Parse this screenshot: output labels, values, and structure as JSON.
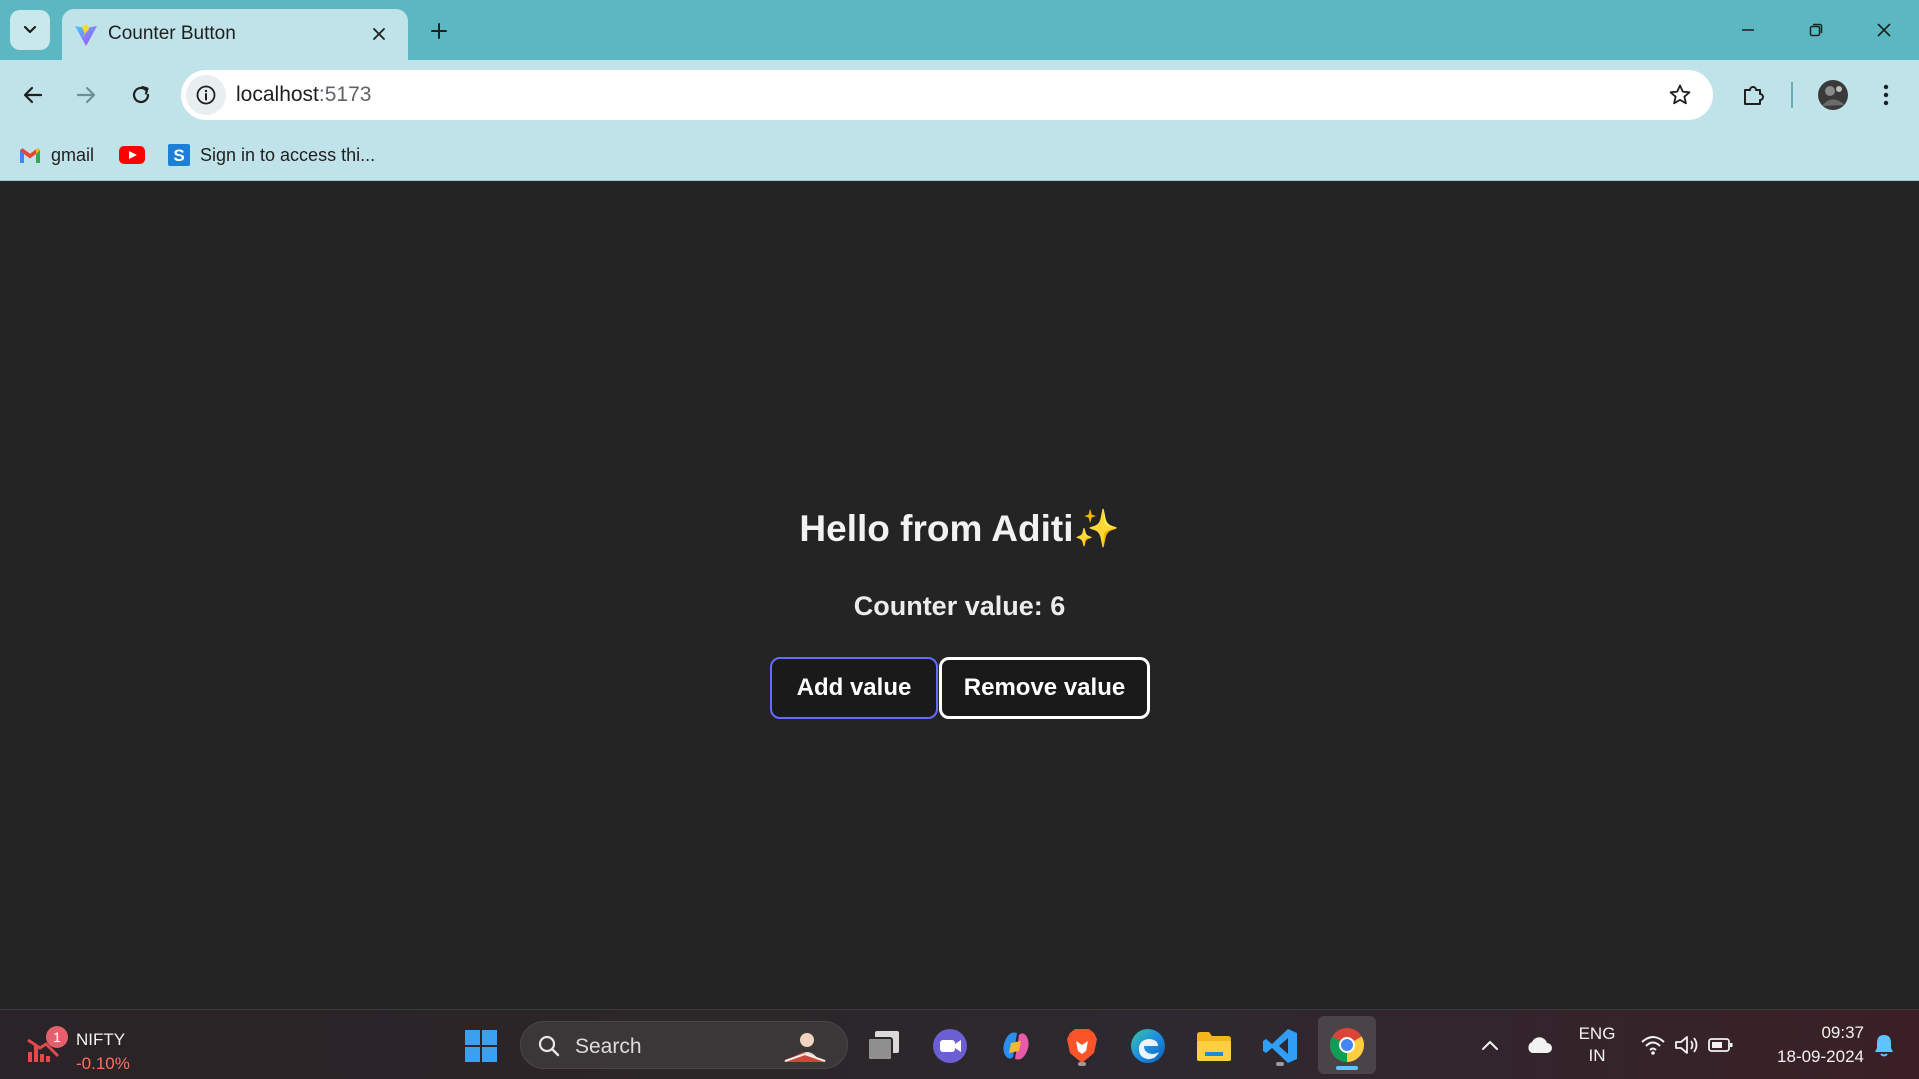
{
  "browser": {
    "tab_title": "Counter Button",
    "url_host": "localhost",
    "url_port": ":5173",
    "bookmarks": [
      {
        "label": "gmail",
        "icon": "gmail-icon"
      },
      {
        "label": "",
        "icon": "youtube-icon"
      },
      {
        "label": "Sign in to access thi...",
        "icon": "s-logo-icon"
      }
    ]
  },
  "page": {
    "heading": "Hello from Aditi✨",
    "counter_text": "Counter value: 6",
    "counter_value": 6,
    "add_label": "Add value",
    "remove_label": "Remove value",
    "add_border_color": "#646cff"
  },
  "taskbar": {
    "widget_label": "NIFTY",
    "widget_change": "-0.10%",
    "widget_badge": "1",
    "search_placeholder": "Search",
    "lang_top": "ENG",
    "lang_bottom": "IN",
    "time": "09:37",
    "date": "18-09-2024"
  },
  "colors": {
    "tabstrip": "#5bb8c3",
    "toolbar": "#bfe3e8",
    "page_bg": "#242424"
  }
}
